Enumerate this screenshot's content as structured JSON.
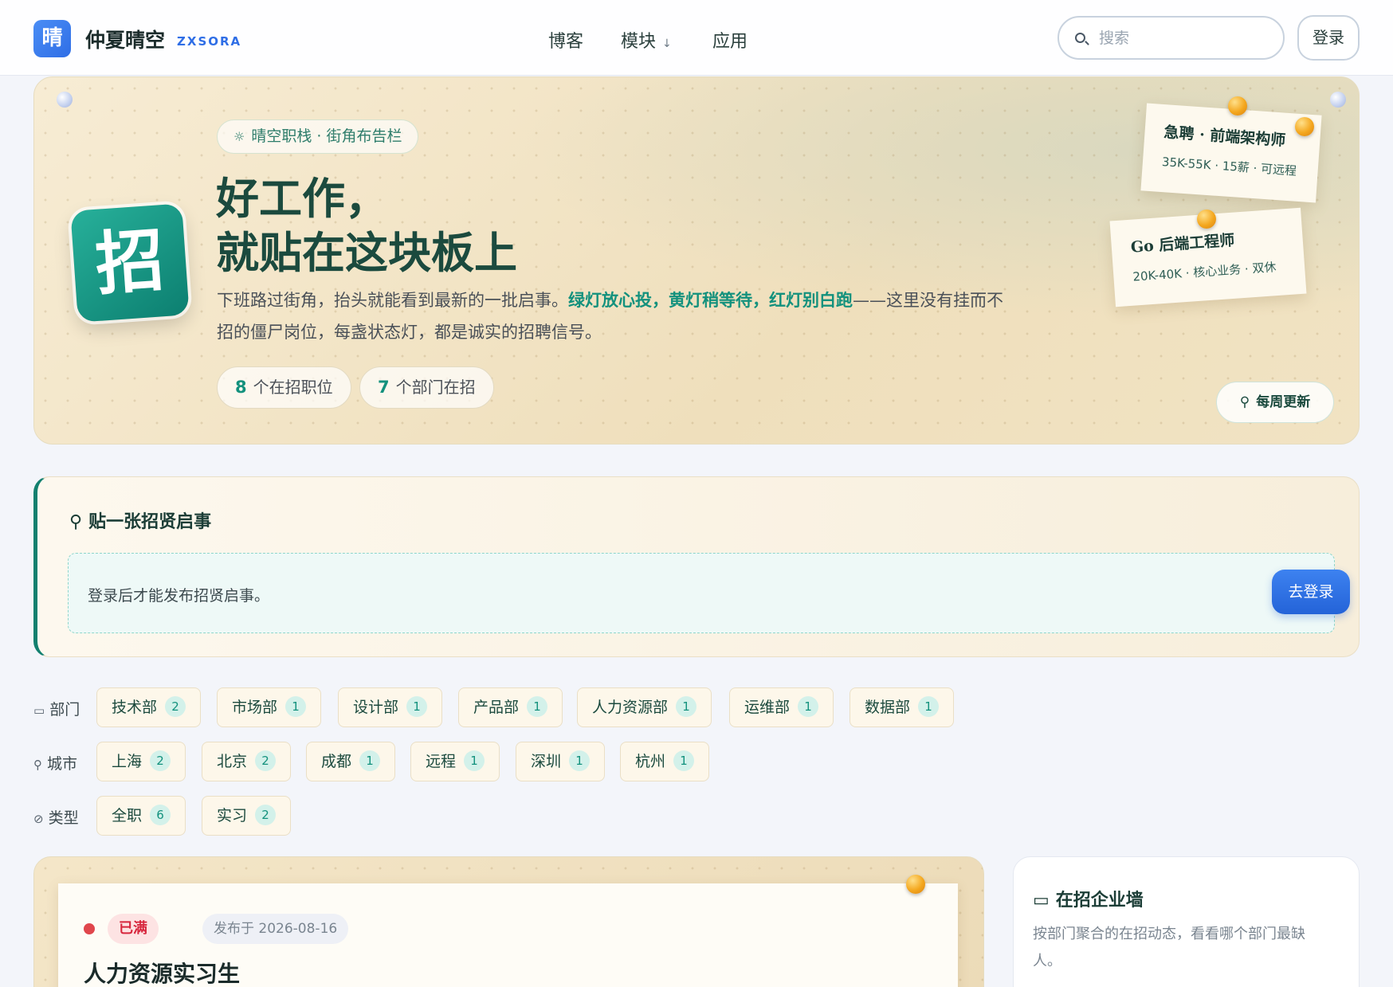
{
  "header": {
    "logo_char": "晴",
    "brand_name": "仲夏晴空",
    "brand_sub": "ZXSORA",
    "nav": [
      {
        "label": "博客"
      },
      {
        "label": "模块",
        "caret": "↓"
      },
      {
        "label": "应用"
      }
    ],
    "search_placeholder": "搜索",
    "login_label": "登录"
  },
  "hero": {
    "badge": "晴空职栈 · 街角布告栏",
    "badge_icon": "☼",
    "logo_char": "招",
    "title_line1": "好工作，",
    "title_line2": "就贴在这块板上",
    "desc_part1": "下班路过街角，抬头就能看到最新的一批启事。",
    "desc_green": "绿灯放心投，",
    "desc_yellow": "黄灯稍等待，",
    "desc_red": "红灯别白跑",
    "desc_part2": "——这里没有挂而不招的僵尸岗位，每盏状态灯，都是诚实的招聘信号。",
    "stats": [
      {
        "num": "8",
        "label": "个在招职位"
      },
      {
        "num": "7",
        "label": "个部门在招"
      }
    ],
    "notes": [
      {
        "title": "急聘 · 前端架构师",
        "sub": "35K-55K · 15薪 · 可远程"
      },
      {
        "title": "Go 后端工程师",
        "sub": "20K-40K · 核心业务 · 双休"
      }
    ],
    "weekly_label": "每周更新",
    "weekly_icon": "⚲"
  },
  "post": {
    "title": "贴一张招贤启事",
    "message": "登录后才能发布招贤启事。",
    "button": "去登录"
  },
  "filters": {
    "department": {
      "label": "部门",
      "items": [
        {
          "name": "技术部",
          "count": "2"
        },
        {
          "name": "市场部",
          "count": "1"
        },
        {
          "name": "设计部",
          "count": "1"
        },
        {
          "name": "产品部",
          "count": "1"
        },
        {
          "name": "人力资源部",
          "count": "1"
        },
        {
          "name": "运维部",
          "count": "1"
        },
        {
          "name": "数据部",
          "count": "1"
        }
      ]
    },
    "city": {
      "label": "城市",
      "items": [
        {
          "name": "上海",
          "count": "2"
        },
        {
          "name": "北京",
          "count": "2"
        },
        {
          "name": "成都",
          "count": "1"
        },
        {
          "name": "远程",
          "count": "1"
        },
        {
          "name": "深圳",
          "count": "1"
        },
        {
          "name": "杭州",
          "count": "1"
        }
      ]
    },
    "type": {
      "label": "类型",
      "items": [
        {
          "name": "全职",
          "count": "6"
        },
        {
          "name": "实习",
          "count": "2"
        }
      ]
    }
  },
  "job": {
    "status": "已满",
    "date": "发布于 2026-08-16",
    "title": "人力资源实习生"
  },
  "company_wall": {
    "title": "在招企业墙",
    "desc": "按部门聚合的在招动态，看看哪个部门最缺人。"
  },
  "colors": {
    "accent": "#13917d",
    "primary_blue": "#2f6ee6",
    "danger": "#d7263d"
  }
}
